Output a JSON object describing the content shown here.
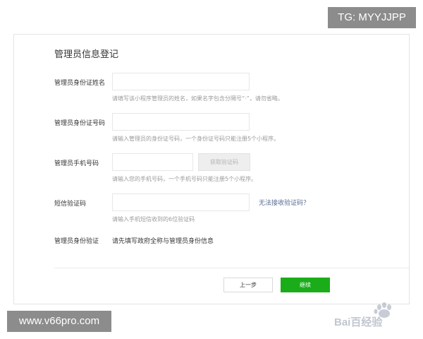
{
  "watermark": {
    "tg": "TG: MYYJJPP",
    "site": "www.v66pro.com",
    "baidu": "Bai百经验"
  },
  "form": {
    "title": "管理员信息登记",
    "fields": [
      {
        "label": "管理员身份证姓名",
        "value": "",
        "hint": "请填写该小程序管理员的姓名，如果名字包含分隔号“·”，请勿省略。"
      },
      {
        "label": "管理员身份证号码",
        "value": "",
        "hint": "请输入管理员的身份证号码，一个身份证号码只能注册5个小程序。"
      },
      {
        "label": "管理员手机号码",
        "value": "",
        "hint": "请输入您的手机号码，一个手机号码只能注册5个小程序。",
        "button": "获取验证码"
      },
      {
        "label": "短信验证码",
        "value": "",
        "hint": "请输入手机短信收到的6位验证码",
        "link": "无法接收验证码？"
      }
    ],
    "verify": {
      "label": "管理员身份验证",
      "value": "请先填写政府全称与管理员身份信息"
    },
    "buttons": {
      "prev": "上一步",
      "next": "继续"
    }
  },
  "colors": {
    "primary": "#1aad19",
    "link": "#576b95",
    "hint": "#9a9a9a",
    "badge": "#8c8c8c"
  }
}
